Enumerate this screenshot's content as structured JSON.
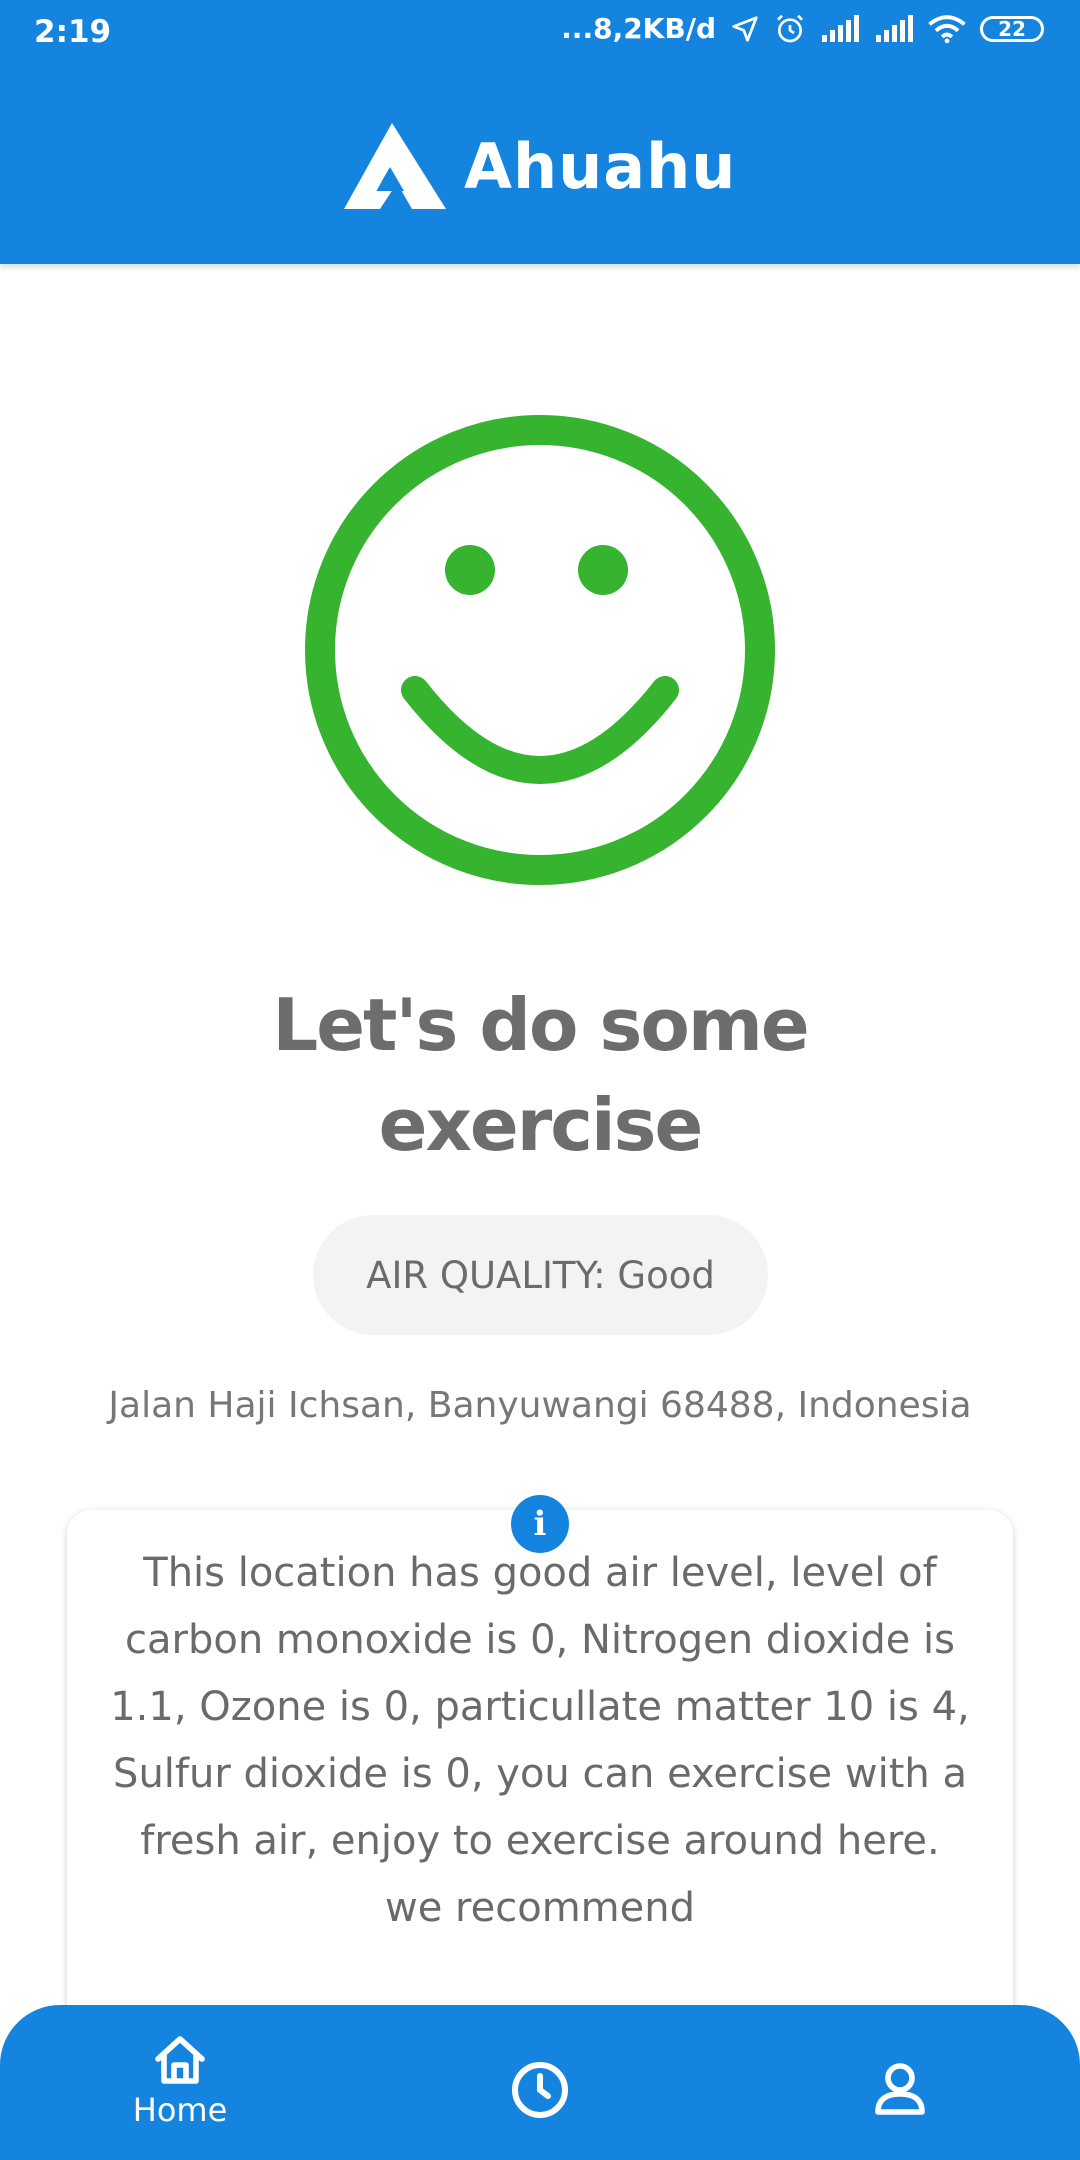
{
  "status_bar": {
    "time": "2:19",
    "network_speed": "...8,2KB/d",
    "battery": "22",
    "icons": [
      "location-arrow-icon",
      "alarm-icon",
      "signal-icon",
      "signal-icon",
      "wifi-icon",
      "battery-icon"
    ]
  },
  "app_bar": {
    "brand": "Ahuahu",
    "logo_icon": "ahuahu-logo-icon",
    "background": "#1584df"
  },
  "status_face": {
    "icon": "smiley-face-icon",
    "color": "#36b32f"
  },
  "headline": {
    "line1": "Let's do some",
    "line2": "exercise"
  },
  "air_quality": {
    "label": "AIR QUALITY: Good"
  },
  "location": {
    "address": "Jalan Haji Ichsan, Banyuwangi 68488, Indonesia"
  },
  "info_card": {
    "icon": "info-icon",
    "icon_glyph": "i",
    "text": "This location has good air level, level of carbon monoxide is 0, Nitrogen dioxide is 1.1, Ozone is 0, particullate matter 10 is 4, Sulfur dioxide is 0, you can exercise with a fresh air, enjoy to exercise around here. we recommend"
  },
  "bottom_nav": {
    "items": [
      {
        "name": "home",
        "label": "Home",
        "icon": "home-icon"
      },
      {
        "name": "history",
        "label": "",
        "icon": "clock-icon"
      },
      {
        "name": "profile",
        "label": "",
        "icon": "user-icon"
      }
    ]
  }
}
